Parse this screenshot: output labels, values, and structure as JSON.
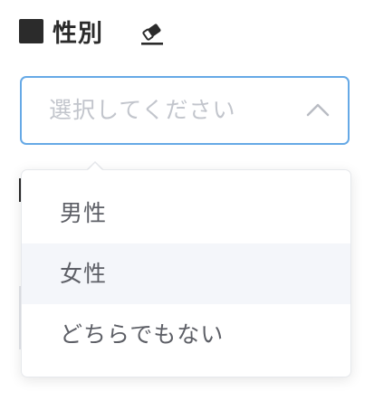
{
  "field": {
    "title": "性別"
  },
  "select": {
    "placeholder": "選択してください",
    "expanded": true
  },
  "dropdown": {
    "options": [
      "男性",
      "女性",
      "どちらでもない"
    ],
    "highlighted_index": 1
  },
  "colors": {
    "focus_border": "#66a9e6",
    "placeholder": "#c2c5cc",
    "option_text": "#5d5f66",
    "hover_bg": "#f4f6fa",
    "title": "#2b2b2b"
  },
  "icons": {
    "clear": "eraser-icon",
    "toggle": "chevron-up-icon"
  }
}
